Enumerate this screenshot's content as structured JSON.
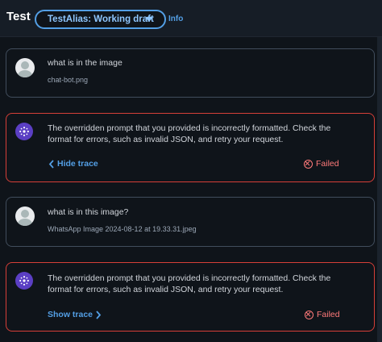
{
  "header": {
    "title": "Test",
    "alias_select": "TestAlias: Working draft",
    "info_link": "Info"
  },
  "messages": [
    {
      "role": "user",
      "text": "what is in the image",
      "attachment": "chat-bot.png"
    },
    {
      "role": "agent",
      "line1": "The overridden prompt that you provided is incorrectly formatted. Check the",
      "line2": "format for errors, such as invalid JSON, and retry your request.",
      "trace_label": "Hide trace",
      "status": "Failed"
    },
    {
      "role": "user",
      "text": "what is in this image?",
      "attachment": "WhatsApp Image 2024-08-12 at 19.33.31.jpeg"
    },
    {
      "role": "agent",
      "line1": "The overridden prompt that you provided is incorrectly formatted. Check the",
      "line2": "format for errors, such as invalid JSON, and retry your request.",
      "trace_label": "Show trace",
      "status": "Failed"
    }
  ],
  "icons": [
    "chevron-down-icon",
    "user-avatar-icon",
    "agent-icon",
    "chevron-left-icon",
    "chevron-right-icon",
    "error-circle-icon"
  ],
  "colors": {
    "accent": "#539fe5",
    "error": "#d63f38",
    "error_text": "#ff7a7a",
    "background": "#0f141a"
  }
}
